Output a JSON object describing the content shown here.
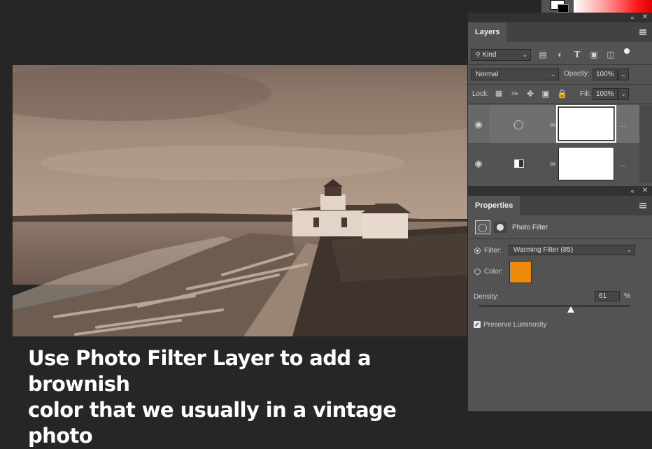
{
  "caption": {
    "line1": "Use Photo Filter Layer to add a brownish",
    "line2": "color that we usually in a vintage photo"
  },
  "layers_panel": {
    "tab": "Layers",
    "filter_kind": "Kind",
    "blend_mode": "Normal",
    "opacity_label": "Opacity:",
    "opacity_value": "100%",
    "lock_label": "Lock:",
    "fill_label": "Fill:",
    "fill_value": "100%",
    "layers": [
      {
        "type": "photo-filter-adjustment",
        "visible": true,
        "selected": true,
        "more": "..."
      },
      {
        "type": "levels-adjustment",
        "visible": true,
        "selected": false,
        "more": "..."
      }
    ]
  },
  "properties_panel": {
    "tab": "Properties",
    "header_title": "Photo Filter",
    "filter_label": "Filter:",
    "filter_value": "Warming Filter (85)",
    "color_label": "Color:",
    "color_value": "#ec8a0b",
    "density_label": "Density:",
    "density_value": "61",
    "density_unit": "%",
    "density_fraction": 0.61,
    "preserve_luminosity_label": "Preserve Luminosity",
    "preserve_luminosity_checked": true,
    "filter_mode": "filter"
  },
  "colors": {
    "panel_bg": "#535353",
    "app_bg": "#262626",
    "sepia_sky": "#a58d7e",
    "sepia_ground": "#5e4f45"
  },
  "icons": [
    "eye-icon",
    "search-icon",
    "image-filter-icon",
    "circle-half-icon",
    "type-icon",
    "transform-icon",
    "document-icon",
    "dot-icon",
    "lock-pixels-icon",
    "brush-icon",
    "move-icon",
    "artboard-icon",
    "lock-icon",
    "link-icon",
    "camera-icon",
    "mask-icon",
    "collapse-icon",
    "close-icon",
    "panel-menu-icon"
  ]
}
